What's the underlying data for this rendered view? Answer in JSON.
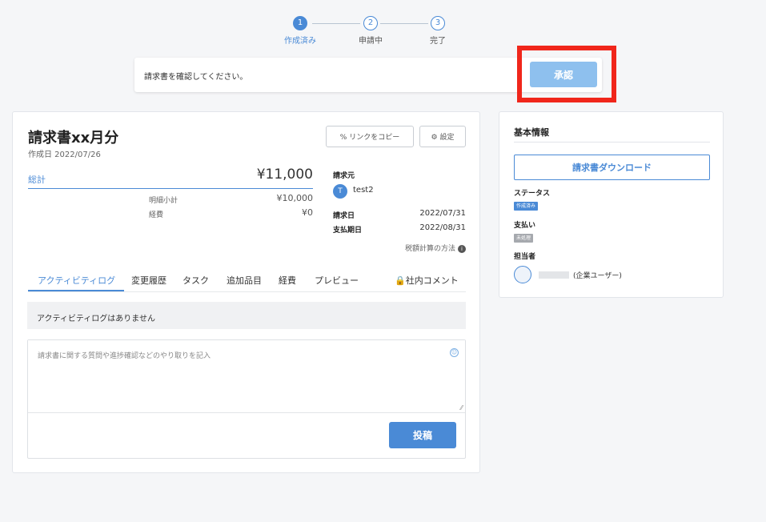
{
  "stepper": {
    "steps": [
      {
        "number": "1",
        "label": "作成済み",
        "active": true
      },
      {
        "number": "2",
        "label": "申請中",
        "active": false
      },
      {
        "number": "3",
        "label": "完了",
        "active": false
      }
    ]
  },
  "banner": {
    "message": "請求書を確認してください。",
    "approve_label": "承認"
  },
  "invoice": {
    "title": "請求書xx月分",
    "created": "作成日 2022/07/26",
    "copy_link_label": "リンクをコピー",
    "settings_label": "設定",
    "total_label": "総計",
    "total_value": "¥11,000",
    "subtotal_label": "明細小計",
    "subtotal_value": "¥10,000",
    "expense_label": "経費",
    "expense_value": "¥0",
    "bill_from_label": "請求元",
    "bill_from_initial": "T",
    "bill_from_name": "test2",
    "bill_date_label": "請求日",
    "bill_date_value": "2022/07/31",
    "due_date_label": "支払期日",
    "due_date_value": "2022/08/31",
    "tax_method_label": "税額計算の方法"
  },
  "tabs": [
    {
      "label": "アクティビティログ",
      "active": true
    },
    {
      "label": "変更履歴",
      "active": false
    },
    {
      "label": "タスク",
      "active": false
    },
    {
      "label": "追加品目",
      "active": false
    },
    {
      "label": "経費",
      "active": false
    },
    {
      "label": "プレビュー",
      "active": false
    }
  ],
  "internal_comment_tab": "社内コメント",
  "activity": {
    "empty_message": "アクティビティログはありません",
    "comment_placeholder": "請求書に関する質問や進捗確認などのやり取りを記入",
    "post_label": "投稿"
  },
  "side": {
    "title": "基本情報",
    "download_label": "請求書ダウンロード",
    "status_label": "ステータス",
    "status_badge": "作成済み",
    "payment_label": "支払い",
    "payment_badge": "未処理",
    "assignee_label": "担当者",
    "assignee_type": "(企業ユーザー)"
  },
  "colors": {
    "accent": "#4a8ad6",
    "highlight": "#f0261b",
    "approve_disabled": "#8ec0ee"
  }
}
